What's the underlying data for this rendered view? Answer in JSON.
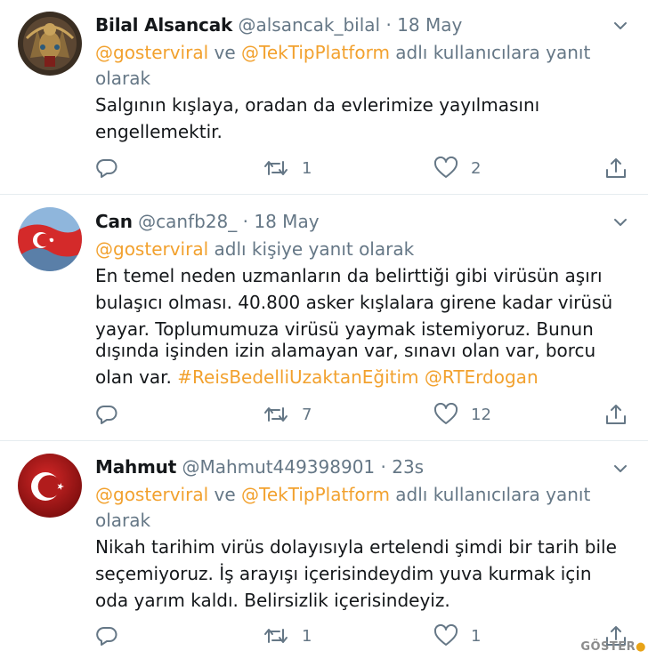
{
  "tweets": [
    {
      "name": "Bilal Alsancak",
      "handle": "@alsancak_bilal",
      "sep": "·",
      "time": "18 May",
      "reply": {
        "mention1": "@gosterviral",
        "conj": " ve ",
        "mention2": "@TekTipPlatform",
        "suffix_line1": " adlı kullanıcılara yanıt",
        "line2": "olarak"
      },
      "body_lines": [
        "Salgının kışlaya, oradan da evlerimize yayılmasını",
        "engellemektir."
      ],
      "retweets": "1",
      "likes": "2",
      "avatar_icon": "ottoman-coat-of-arms"
    },
    {
      "name": "Can",
      "handle": "@canfb28_",
      "sep": "·",
      "time": "18 May",
      "reply": {
        "mention1": "@gosterviral",
        "suffix_line1": " adlı kişiye yanıt olarak"
      },
      "body_lines": [
        "En temel neden uzmanların da belirttiği gibi virüsün aşırı",
        "bulaşıcı olması. 40.800 asker kışlalara girene kadar virüsü",
        "yayar. Toplumumuza virüsü yaymak istemiyoruz. Bunun",
        "dışında işinden izin alamayan var, sınavı olan var, borcu"
      ],
      "last_line_text": "olan var. ",
      "hashtag": "#ReisBedelliUzaktanEğitim",
      "last_mention": "@RTErdogan",
      "retweets": "7",
      "likes": "12",
      "avatar_icon": "turkish-flag"
    },
    {
      "name": "Mahmut",
      "handle": "@Mahmut449398901",
      "sep": "·",
      "time": "23s",
      "reply": {
        "mention1": "@gosterviral",
        "conj": " ve ",
        "mention2": "@TekTipPlatform",
        "suffix_line1": " adlı kullanıcılara yanıt",
        "line2": "olarak"
      },
      "body_lines": [
        "Nikah tarihim virüs  dolayısıyla  ertelendi şimdi bir tarih bile",
        "seçemiyoruz.  İş arayışı  içerisindeydim yuva kurmak  için",
        "oda yarım kaldı.  Belirsizlik içerisindeyiz."
      ],
      "retweets": "1",
      "likes": "1",
      "avatar_icon": "crescent-star"
    }
  ],
  "colors": {
    "accent": "#f2a12e",
    "muted": "#657786",
    "text": "#14171a",
    "divider": "#e6ecf0"
  },
  "watermark": "GÖSTER"
}
